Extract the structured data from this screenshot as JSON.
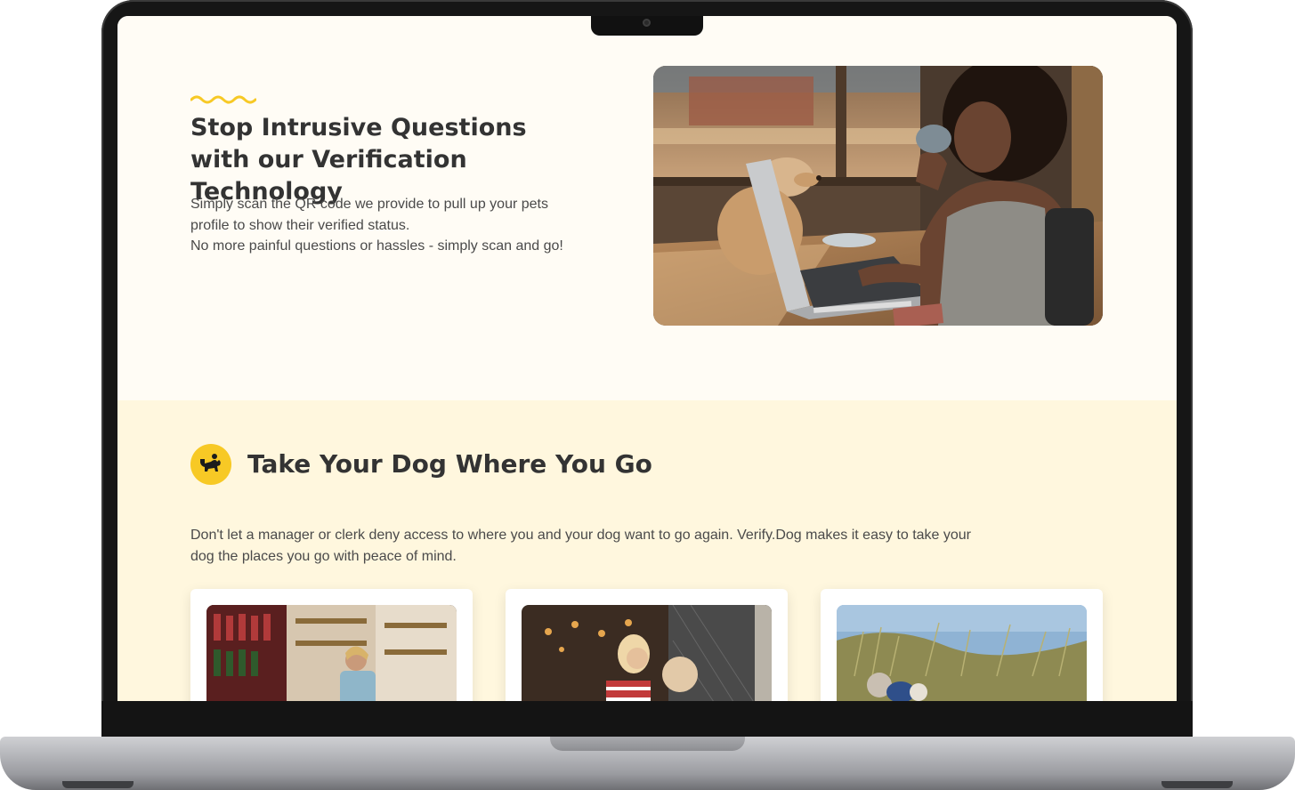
{
  "hero": {
    "title": "Stop Intrusive Questions with our Verification Technology",
    "body_lines": [
      "Simply scan the QR code we provide to pull up your pets profile to show their verified status.",
      "No more painful questions or hassles - simply scan and go!"
    ],
    "image_icon": "woman-with-dog-at-laptop-photo"
  },
  "section": {
    "title": "Take Your Dog Where You Go",
    "icon": "dog-icon",
    "body": "Don't let a manager or clerk deny access to where you and your dog want to go again. Verify.Dog makes it easy to take your dog the places you go with peace of mind."
  },
  "cards": [
    {
      "icon": "wine-store-photo"
    },
    {
      "icon": "cafe-with-dog-photo"
    },
    {
      "icon": "dog-in-grass-photo"
    }
  ],
  "colors": {
    "accent": "#f7c925",
    "hero_bg": "#fffcf5",
    "section_bg": "#fff7de",
    "text": "#333333"
  }
}
